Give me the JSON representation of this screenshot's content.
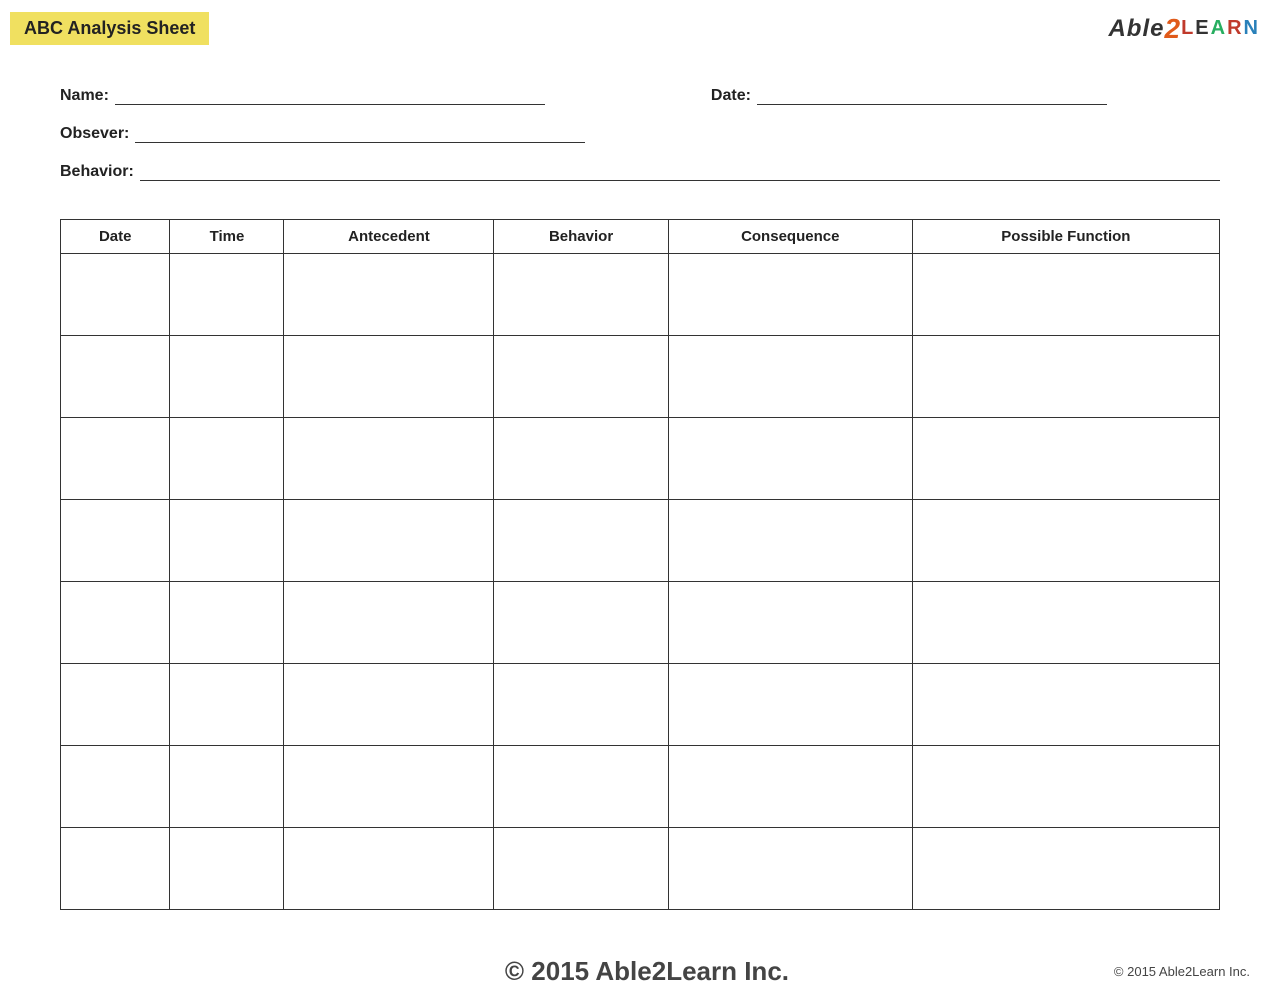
{
  "header": {
    "title": "ABC Analysis Sheet",
    "logo_text": "Able2LEARN"
  },
  "form": {
    "name_label": "Name:",
    "date_label": "Date:",
    "observer_label": "Obsever:",
    "behavior_label": "Behavior:"
  },
  "table": {
    "columns": [
      "Date",
      "Time",
      "Antecedent",
      "Behavior",
      "Consequence",
      "Possible Function"
    ],
    "row_count": 8
  },
  "footer": {
    "center_text": "© 2015 Able2Learn Inc.",
    "right_text": "© 2015 Able2Learn Inc."
  }
}
